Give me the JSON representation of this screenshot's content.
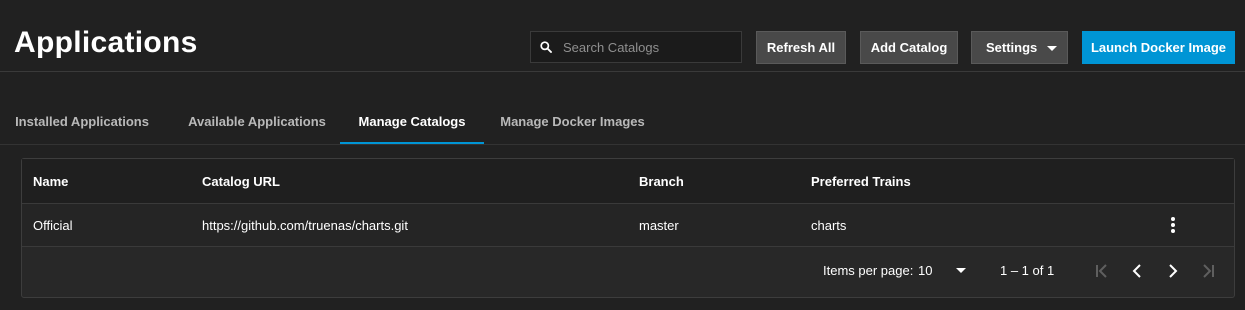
{
  "page": {
    "title": "Applications"
  },
  "search": {
    "placeholder": "Search Catalogs",
    "icon": "search-icon"
  },
  "toolbar": {
    "refresh_label": "Refresh All",
    "add_label": "Add Catalog",
    "settings_label": "Settings",
    "launch_label": "Launch Docker Image",
    "accent_color": "#0095d5"
  },
  "tabs": [
    {
      "label": "Installed Applications",
      "active": false
    },
    {
      "label": "Available Applications",
      "active": false
    },
    {
      "label": "Manage Catalogs",
      "active": true
    },
    {
      "label": "Manage Docker Images",
      "active": false
    }
  ],
  "table": {
    "columns": [
      "Name",
      "Catalog URL",
      "Branch",
      "Preferred Trains"
    ],
    "rows": [
      {
        "name": "Official",
        "url": "https://github.com/truenas/charts.git",
        "branch": "master",
        "trains": "charts"
      }
    ]
  },
  "paginator": {
    "items_per_page_label": "Items per page:",
    "items_per_page": "10",
    "range": "1 – 1 of 1"
  }
}
